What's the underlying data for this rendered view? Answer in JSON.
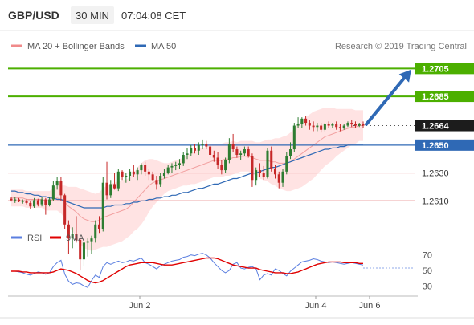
{
  "header": {
    "symbol": "GBP/USD",
    "timeframe": "30 MIN",
    "time": "07:04:08 CET"
  },
  "legend": {
    "bollinger_label": "MA 20 + Bollinger Bands",
    "ma50_label": "MA 50",
    "copyright": "Research © 2019 Trading Central"
  },
  "rsi_legend": {
    "rsi_label": "RSI",
    "ma9_label": "9MA"
  },
  "colors": {
    "bull": "#2e7d32",
    "bear": "#c62828",
    "level_green": "#4caf00",
    "level_red": "#e88a8a",
    "ma50": "#2f69b5",
    "boll_fill": "#ffdede",
    "rsi": "#5b7fe0",
    "ma9": "#e00000",
    "arrow": "#2f69b5"
  },
  "chart_data": [
    {
      "type": "candlestick",
      "title": "GBP/USD 30 MIN",
      "ylim": [
        1.259,
        1.2715
      ],
      "x_labels": [
        "Jun 2",
        "Jun 4",
        "Jun 6"
      ],
      "y_labels": [
        "1.2705",
        "1.2685",
        "1.2664",
        "1.2650",
        "1.2630",
        "1.2610"
      ],
      "levels": [
        {
          "value": 1.2705,
          "label": "1.2705",
          "kind": "resistance"
        },
        {
          "value": 1.2685,
          "label": "1.2685",
          "kind": "resistance"
        },
        {
          "value": 1.2664,
          "label": "1.2664",
          "kind": "last"
        },
        {
          "value": 1.265,
          "label": "1.2650",
          "kind": "ma50"
        },
        {
          "value": 1.263,
          "label": "1.2630",
          "kind": "support"
        },
        {
          "value": 1.261,
          "label": "1.2610",
          "kind": "support"
        }
      ],
      "candles": [
        [
          1.26115,
          1.26125,
          1.26095,
          1.26105
        ],
        [
          1.26105,
          1.26125,
          1.26085,
          1.2611
        ],
        [
          1.2611,
          1.2612,
          1.2609,
          1.26095
        ],
        [
          1.26095,
          1.2611,
          1.2608,
          1.261
        ],
        [
          1.261,
          1.2611,
          1.26075,
          1.26085
        ],
        [
          1.26085,
          1.261,
          1.2604,
          1.2606
        ],
        [
          1.2606,
          1.2612,
          1.2605,
          1.26105
        ],
        [
          1.26105,
          1.26115,
          1.2606,
          1.26075
        ],
        [
          1.26075,
          1.26125,
          1.2606,
          1.2611
        ],
        [
          1.2611,
          1.2612,
          1.26,
          1.2607
        ],
        [
          1.2607,
          1.2613,
          1.2606,
          1.2611
        ],
        [
          1.2611,
          1.2624,
          1.261,
          1.2621
        ],
        [
          1.2621,
          1.2627,
          1.2618,
          1.2624
        ],
        [
          1.2624,
          1.2627,
          1.261,
          1.2614
        ],
        [
          1.2614,
          1.2615,
          1.259,
          1.2593
        ],
        [
          1.2593,
          1.2596,
          1.2572,
          1.2583
        ],
        [
          1.2583,
          1.2591,
          1.2576,
          1.2586
        ],
        [
          1.2586,
          1.2599,
          1.258,
          1.2582
        ],
        [
          1.2582,
          1.2583,
          1.256,
          1.2568
        ],
        [
          1.2568,
          1.2582,
          1.2563,
          1.258
        ],
        [
          1.258,
          1.2583,
          1.257,
          1.2581
        ],
        [
          1.2581,
          1.2585,
          1.2572,
          1.2583
        ],
        [
          1.2583,
          1.2596,
          1.258,
          1.2593
        ],
        [
          1.2593,
          1.2599,
          1.2587,
          1.259
        ],
        [
          1.259,
          1.2627,
          1.2588,
          1.2623
        ],
        [
          1.2623,
          1.2638,
          1.2611,
          1.2614
        ],
        [
          1.2614,
          1.2625,
          1.2612,
          1.2622
        ],
        [
          1.2622,
          1.263,
          1.2618,
          1.2619
        ],
        [
          1.2619,
          1.2633,
          1.2617,
          1.2631
        ],
        [
          1.2631,
          1.2632,
          1.2625,
          1.2627
        ],
        [
          1.2627,
          1.263,
          1.2623,
          1.2628
        ],
        [
          1.2628,
          1.2633,
          1.2624,
          1.2631
        ],
        [
          1.2631,
          1.2636,
          1.2627,
          1.2629
        ],
        [
          1.2629,
          1.2634,
          1.2625,
          1.2632
        ],
        [
          1.2632,
          1.2637,
          1.2629,
          1.2636
        ],
        [
          1.2636,
          1.2638,
          1.2628,
          1.2631
        ],
        [
          1.2631,
          1.2633,
          1.2625,
          1.2629
        ],
        [
          1.2629,
          1.2631,
          1.2624,
          1.2625
        ],
        [
          1.2625,
          1.2628,
          1.2618,
          1.2622
        ],
        [
          1.2622,
          1.263,
          1.262,
          1.2628
        ],
        [
          1.2628,
          1.2633,
          1.2626,
          1.263
        ],
        [
          1.263,
          1.2636,
          1.2629,
          1.2634
        ],
        [
          1.2634,
          1.2637,
          1.263,
          1.2635
        ],
        [
          1.2635,
          1.2638,
          1.2632,
          1.2636
        ],
        [
          1.2636,
          1.264,
          1.2633,
          1.2637
        ],
        [
          1.2637,
          1.2645,
          1.2635,
          1.2643
        ],
        [
          1.2643,
          1.2648,
          1.264,
          1.2644
        ],
        [
          1.2644,
          1.265,
          1.2642,
          1.2648
        ],
        [
          1.2648,
          1.2651,
          1.2644,
          1.2646
        ],
        [
          1.2646,
          1.2652,
          1.2643,
          1.265
        ],
        [
          1.265,
          1.2654,
          1.2647,
          1.2651
        ],
        [
          1.2651,
          1.2653,
          1.2647,
          1.2649
        ],
        [
          1.2649,
          1.2651,
          1.2641,
          1.2643
        ],
        [
          1.2643,
          1.2646,
          1.2638,
          1.2641
        ],
        [
          1.2641,
          1.2645,
          1.2633,
          1.2636
        ],
        [
          1.2636,
          1.2639,
          1.2629,
          1.2632
        ],
        [
          1.2632,
          1.2641,
          1.263,
          1.2639
        ],
        [
          1.2639,
          1.2655,
          1.2637,
          1.2651
        ],
        [
          1.2651,
          1.2658,
          1.2645,
          1.2647
        ],
        [
          1.2647,
          1.2649,
          1.2641,
          1.2643
        ],
        [
          1.2643,
          1.2646,
          1.2639,
          1.2644
        ],
        [
          1.2644,
          1.2649,
          1.2642,
          1.2647
        ],
        [
          1.2647,
          1.2649,
          1.2641,
          1.2642
        ],
        [
          1.2642,
          1.2644,
          1.262,
          1.2625
        ],
        [
          1.2625,
          1.2634,
          1.2621,
          1.2632
        ],
        [
          1.2632,
          1.2637,
          1.2627,
          1.263
        ],
        [
          1.263,
          1.2635,
          1.2625,
          1.2627
        ],
        [
          1.2627,
          1.2648,
          1.2626,
          1.2646
        ],
        [
          1.2646,
          1.2649,
          1.2631,
          1.2633
        ],
        [
          1.2633,
          1.2636,
          1.2626,
          1.2629
        ],
        [
          1.2629,
          1.2631,
          1.2619,
          1.2623
        ],
        [
          1.2623,
          1.2633,
          1.262,
          1.2631
        ],
        [
          1.2631,
          1.2645,
          1.2629,
          1.2642
        ],
        [
          1.2642,
          1.2652,
          1.264,
          1.2647
        ],
        [
          1.2647,
          1.2666,
          1.2645,
          1.2664
        ],
        [
          1.2664,
          1.267,
          1.2662,
          1.2665
        ],
        [
          1.2665,
          1.267,
          1.2662,
          1.2669
        ],
        [
          1.2669,
          1.2671,
          1.2664,
          1.2666
        ],
        [
          1.2666,
          1.2668,
          1.2661,
          1.2664
        ],
        [
          1.2664,
          1.2667,
          1.266,
          1.2663
        ],
        [
          1.2663,
          1.2666,
          1.266,
          1.2664
        ],
        [
          1.2664,
          1.2666,
          1.2659,
          1.2661
        ],
        [
          1.2661,
          1.2666,
          1.266,
          1.2665
        ],
        [
          1.2665,
          1.2667,
          1.2662,
          1.2664
        ],
        [
          1.2664,
          1.2666,
          1.2662,
          1.2665
        ],
        [
          1.2665,
          1.2667,
          1.2661,
          1.2663
        ],
        [
          1.2663,
          1.2665,
          1.266,
          1.2662
        ],
        [
          1.2662,
          1.2665,
          1.2661,
          1.2664
        ],
        [
          1.2664,
          1.2667,
          1.2663,
          1.2666
        ],
        [
          1.2666,
          1.2668,
          1.2663,
          1.2665
        ],
        [
          1.2665,
          1.2667,
          1.2662,
          1.2664
        ],
        [
          1.2664,
          1.2666,
          1.2663,
          1.2665
        ],
        [
          1.2665,
          1.2667,
          1.2662,
          1.2664
        ]
      ],
      "ma20": [
        1.2612,
        1.2612,
        1.2612,
        1.2612,
        1.2611,
        1.2611,
        1.2611,
        1.2611,
        1.2611,
        1.261,
        1.261,
        1.2611,
        1.2612,
        1.2611,
        1.2609,
        1.2606,
        1.2604,
        1.2602,
        1.2599,
        1.2597,
        1.2596,
        1.2595,
        1.2595,
        1.2596,
        1.2598,
        1.2599,
        1.26,
        1.2601,
        1.2602,
        1.2603,
        1.2604,
        1.2606,
        1.2609,
        1.2612,
        1.2615,
        1.2618,
        1.2621,
        1.2623,
        1.2624,
        1.2625,
        1.2626,
        1.2627,
        1.2628,
        1.2629,
        1.263,
        1.2631,
        1.2632,
        1.2633,
        1.2634,
        1.2635,
        1.2636,
        1.2637,
        1.2638,
        1.2639,
        1.2639,
        1.2639,
        1.264,
        1.264,
        1.2641,
        1.2641,
        1.2642,
        1.2642,
        1.2642,
        1.2641,
        1.264,
        1.2639,
        1.2639,
        1.2639,
        1.2638,
        1.2638,
        1.2637,
        1.2637,
        1.2637,
        1.2638,
        1.264,
        1.2642,
        1.2644,
        1.2646,
        1.2648,
        1.265,
        1.2652,
        1.2654,
        1.2656,
        1.2657,
        1.2658,
        1.2659,
        1.266,
        1.2661,
        1.2662,
        1.2663,
        1.2663,
        1.2664,
        1.2664
      ],
      "bb_width": [
        0.0006,
        0.0006,
        0.0006,
        0.0006,
        0.0006,
        0.0006,
        0.0006,
        0.0006,
        0.0006,
        0.0007,
        0.0007,
        0.0008,
        0.0009,
        0.001,
        0.0012,
        0.0014,
        0.0016,
        0.0018,
        0.002,
        0.0021,
        0.0021,
        0.0021,
        0.002,
        0.002,
        0.0021,
        0.0022,
        0.0022,
        0.0022,
        0.0022,
        0.0022,
        0.0021,
        0.0021,
        0.0021,
        0.0022,
        0.0022,
        0.0021,
        0.0019,
        0.0017,
        0.0015,
        0.0013,
        0.0011,
        0.001,
        0.001,
        0.001,
        0.001,
        0.001,
        0.0011,
        0.0011,
        0.0012,
        0.0012,
        0.0012,
        0.0012,
        0.0012,
        0.0012,
        0.0012,
        0.0012,
        0.0012,
        0.0012,
        0.0012,
        0.0011,
        0.0011,
        0.0011,
        0.0011,
        0.0012,
        0.0012,
        0.0013,
        0.0014,
        0.0015,
        0.0016,
        0.0017,
        0.0018,
        0.0019,
        0.002,
        0.0021,
        0.0022,
        0.0023,
        0.0024,
        0.0024,
        0.0024,
        0.0024,
        0.0023,
        0.0022,
        0.0021,
        0.002,
        0.0019,
        0.0017,
        0.0016,
        0.0015,
        0.0014,
        0.0013,
        0.0012,
        0.0011,
        0.0011
      ],
      "ma50": [
        1.2617,
        1.2617,
        1.2616,
        1.2616,
        1.2615,
        1.2615,
        1.2614,
        1.2614,
        1.2613,
        1.2613,
        1.2612,
        1.2612,
        1.2611,
        1.2611,
        1.261,
        1.2609,
        1.2608,
        1.2607,
        1.2606,
        1.2605,
        1.2605,
        1.2605,
        1.2605,
        1.2605,
        1.2605,
        1.2606,
        1.2606,
        1.2607,
        1.2607,
        1.2607,
        1.2608,
        1.2608,
        1.2609,
        1.2609,
        1.261,
        1.261,
        1.2611,
        1.2611,
        1.2612,
        1.2612,
        1.2613,
        1.2613,
        1.2614,
        1.2614,
        1.2615,
        1.2616,
        1.2616,
        1.2617,
        1.2618,
        1.2619,
        1.2619,
        1.262,
        1.2621,
        1.2622,
        1.2622,
        1.2623,
        1.2624,
        1.2625,
        1.2626,
        1.2626,
        1.2627,
        1.2628,
        1.2629,
        1.263,
        1.263,
        1.2631,
        1.2632,
        1.2633,
        1.2634,
        1.2634,
        1.2635,
        1.2636,
        1.2637,
        1.2638,
        1.2639,
        1.264,
        1.2641,
        1.2642,
        1.2643,
        1.2644,
        1.2645,
        1.2646,
        1.2647,
        1.2647,
        1.2648,
        1.2648,
        1.2649,
        1.2649,
        1.265,
        1.265,
        1.265,
        1.265,
        1.265
      ],
      "forecast_arrow": {
        "from_value": 1.2665,
        "to_value": 1.2705
      }
    },
    {
      "type": "line",
      "title": "RSI",
      "ylim": [
        20,
        80
      ],
      "y_labels": [
        "70",
        "50",
        "30"
      ],
      "series": [
        {
          "name": "RSI",
          "values": [
            49,
            49,
            48,
            47,
            45,
            44,
            46,
            48,
            47,
            45,
            47,
            55,
            60,
            63,
            45,
            36,
            32,
            34,
            33,
            30,
            28,
            37,
            44,
            41,
            55,
            60,
            58,
            60,
            62,
            60,
            61,
            63,
            62,
            64,
            66,
            60,
            58,
            55,
            52,
            56,
            58,
            60,
            62,
            63,
            64,
            67,
            68,
            70,
            69,
            71,
            72,
            70,
            66,
            60,
            55,
            50,
            47,
            50,
            58,
            60,
            53,
            52,
            54,
            55,
            52,
            38,
            44,
            46,
            44,
            52,
            50,
            46,
            43,
            49,
            53,
            57,
            61,
            62,
            63,
            65,
            64,
            62,
            61,
            60,
            61,
            60,
            59,
            58,
            59,
            60,
            59,
            58,
            57
          ]
        },
        {
          "name": "9MA",
          "values": [
            49,
            49,
            49,
            48,
            48,
            47,
            47,
            47,
            47,
            47,
            47,
            48,
            50,
            52,
            51,
            50,
            48,
            46,
            43,
            40,
            37,
            35,
            34,
            35,
            37,
            40,
            43,
            46,
            49,
            52,
            55,
            57,
            58,
            59,
            60,
            60,
            60,
            60,
            59,
            58,
            57,
            57,
            57,
            58,
            59,
            60,
            61,
            62,
            63,
            64,
            65,
            66,
            66,
            66,
            65,
            63,
            61,
            59,
            57,
            56,
            55,
            54,
            53,
            53,
            53,
            51,
            50,
            49,
            48,
            47,
            47,
            47,
            46,
            46,
            47,
            48,
            50,
            52,
            54,
            56,
            58,
            59,
            60,
            61,
            61,
            61,
            61,
            60,
            60,
            60,
            60,
            59,
            59
          ]
        }
      ]
    }
  ]
}
